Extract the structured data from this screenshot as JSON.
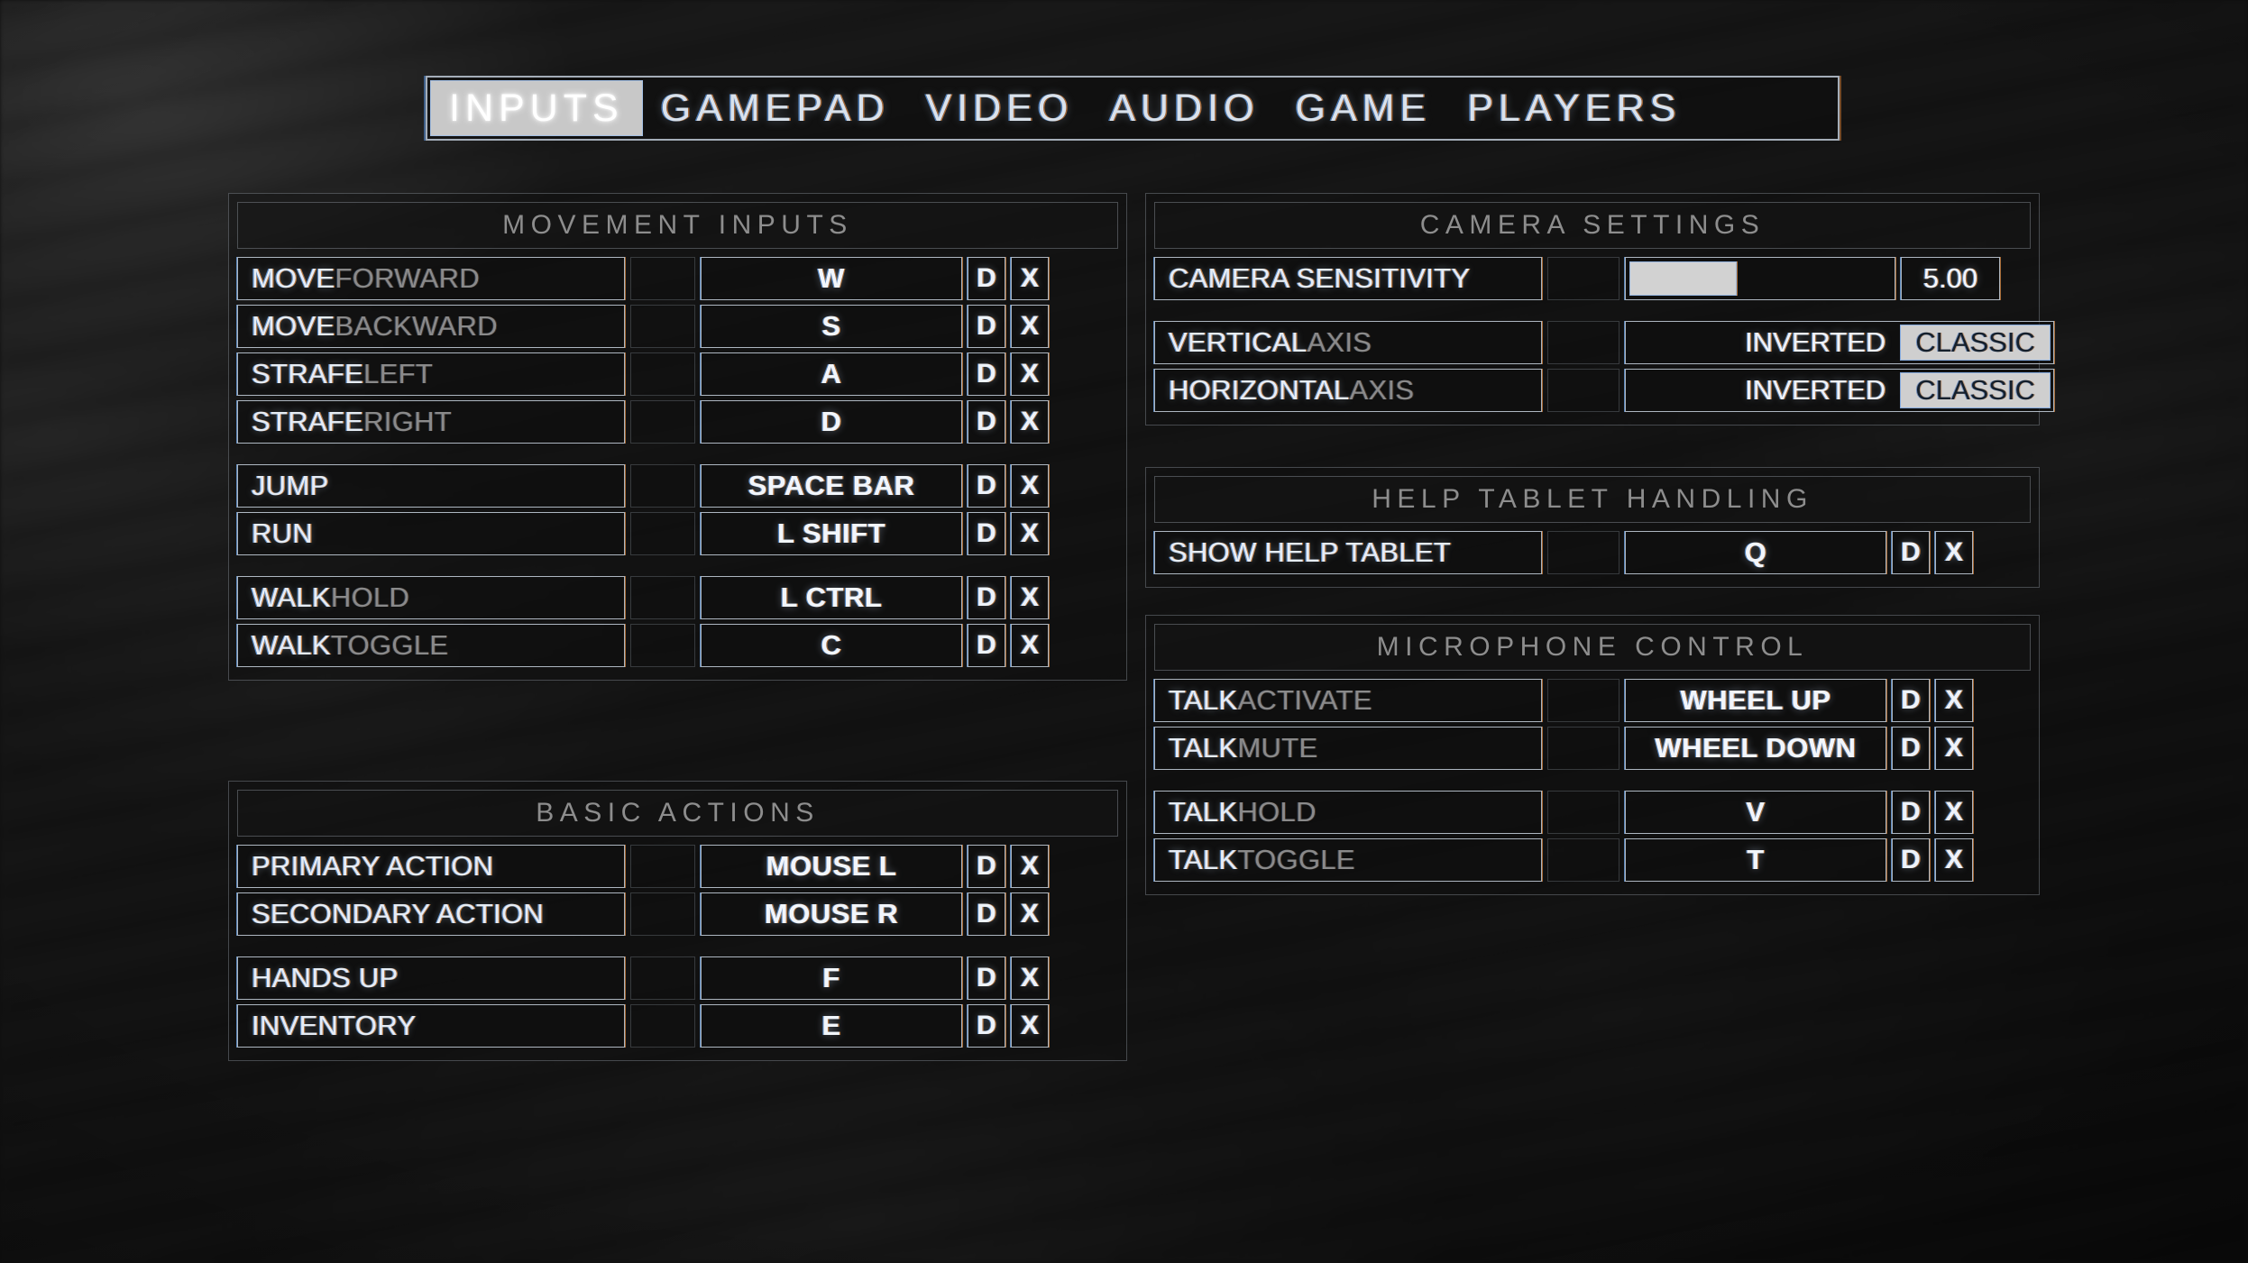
{
  "tabs": [
    {
      "label": "INPUTS",
      "active": true
    },
    {
      "label": "GAMEPAD",
      "active": false
    },
    {
      "label": "VIDEO",
      "active": false
    },
    {
      "label": "AUDIO",
      "active": false
    },
    {
      "label": "GAME",
      "active": false
    },
    {
      "label": "PLAYERS",
      "active": false
    }
  ],
  "colors": {
    "accent_blue": "#5f9be4",
    "accent_orange": "#dc883e",
    "text_primary": "#e6edf5",
    "text_secondary": "#8a8a8a",
    "highlight_bg": "#cfcfcf",
    "panel_bg": "#101010"
  },
  "buttons": {
    "default_label": "D",
    "clear_label": "X"
  },
  "panels": {
    "movement": {
      "title": "MOVEMENT INPUTS",
      "groups": [
        {
          "rows": [
            {
              "word1": "MOVE",
              "word2": "FORWARD",
              "bind": "W"
            },
            {
              "word1": "MOVE",
              "word2": "BACKWARD",
              "bind": "S"
            },
            {
              "word1": "STRAFE",
              "word2": "LEFT",
              "bind": "A"
            },
            {
              "word1": "STRAFE",
              "word2": "RIGHT",
              "bind": "D"
            }
          ]
        },
        {
          "rows": [
            {
              "word1": "JUMP",
              "word2": "",
              "bind": "SPACE BAR"
            },
            {
              "word1": "RUN",
              "word2": "",
              "bind": "L SHIFT"
            }
          ]
        },
        {
          "rows": [
            {
              "word1": "WALK",
              "word2": "HOLD",
              "bind": "L CTRL"
            },
            {
              "word1": "WALK",
              "word2": "TOGGLE",
              "bind": "C"
            }
          ]
        }
      ]
    },
    "basic": {
      "title": "BASIC ACTIONS",
      "groups": [
        {
          "rows": [
            {
              "word1": "PRIMARY ACTION",
              "word2": "",
              "bind": "MOUSE L"
            },
            {
              "word1": "SECONDARY ACTION",
              "word2": "",
              "bind": "MOUSE R"
            }
          ]
        },
        {
          "rows": [
            {
              "word1": "HANDS UP",
              "word2": "",
              "bind": "F"
            },
            {
              "word1": "INVENTORY",
              "word2": "",
              "bind": "E"
            }
          ]
        }
      ]
    },
    "camera": {
      "title": "CAMERA SETTINGS",
      "sensitivity": {
        "word1": "CAMERA SENSITIVITY",
        "word2": "",
        "value": "5.00",
        "fill_percent": 41
      },
      "axes": [
        {
          "word1": "VERTICAL",
          "word2": "AXIS",
          "options": [
            {
              "label": "INVERTED",
              "selected": false
            },
            {
              "label": "CLASSIC",
              "selected": true
            }
          ]
        },
        {
          "word1": "HORIZONTAL",
          "word2": "AXIS",
          "options": [
            {
              "label": "INVERTED",
              "selected": false
            },
            {
              "label": "CLASSIC",
              "selected": true
            }
          ]
        }
      ]
    },
    "help": {
      "title": "HELP TABLET HANDLING",
      "groups": [
        {
          "rows": [
            {
              "word1": "SHOW HELP TABLET",
              "word2": "",
              "bind": "Q"
            }
          ]
        }
      ]
    },
    "mic": {
      "title": "MICROPHONE CONTROL",
      "groups": [
        {
          "rows": [
            {
              "word1": "TALK",
              "word2": "ACTIVATE",
              "bind": "WHEEL UP"
            },
            {
              "word1": "TALK",
              "word2": "MUTE",
              "bind": "WHEEL DOWN"
            }
          ]
        },
        {
          "rows": [
            {
              "word1": "TALK",
              "word2": "HOLD",
              "bind": "V"
            },
            {
              "word1": "TALK",
              "word2": "TOGGLE",
              "bind": "T"
            }
          ]
        }
      ]
    }
  }
}
